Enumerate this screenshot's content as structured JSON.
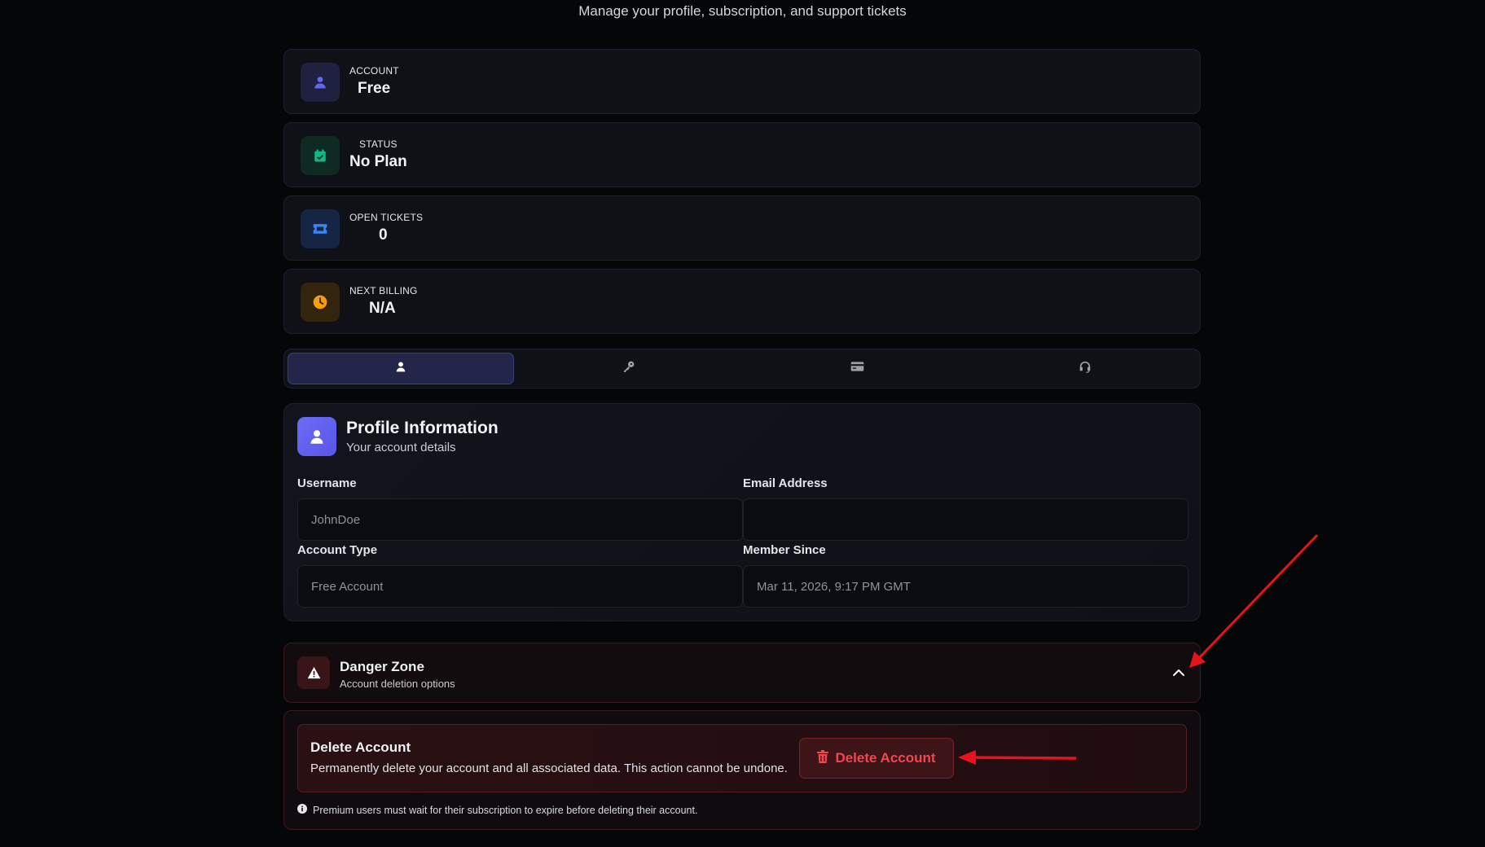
{
  "header": {
    "subtitle": "Manage your profile, subscription, and support tickets"
  },
  "stats": [
    {
      "label": "ACCOUNT",
      "value": "Free",
      "icon": "user-icon",
      "color": "#6366f1",
      "bg": "#1e2140"
    },
    {
      "label": "STATUS",
      "value": "No Plan",
      "icon": "calendar-check-icon",
      "color": "#10b981",
      "bg": "#0f2a22"
    },
    {
      "label": "OPEN TICKETS",
      "value": "0",
      "icon": "ticket-icon",
      "color": "#3b82f6",
      "bg": "#152544"
    },
    {
      "label": "NEXT BILLING",
      "value": "N/A",
      "icon": "clock-icon",
      "color": "#f59e0b",
      "bg": "#33240d"
    }
  ],
  "tabs": [
    {
      "icon": "user-icon",
      "active": true
    },
    {
      "icon": "key-icon",
      "active": false
    },
    {
      "icon": "credit-card-icon",
      "active": false
    },
    {
      "icon": "headset-icon",
      "active": false
    }
  ],
  "profile": {
    "title": "Profile Information",
    "subtitle": "Your account details",
    "fields": {
      "username": {
        "label": "Username",
        "value": "JohnDoe"
      },
      "email": {
        "label": "Email Address",
        "value": ""
      },
      "account_type": {
        "label": "Account Type",
        "value": "Free Account"
      },
      "member_since": {
        "label": "Member Since",
        "value": "Mar 11, 2026, 9:17 PM GMT"
      }
    }
  },
  "danger": {
    "title": "Danger Zone",
    "subtitle": "Account deletion options",
    "delete_title": "Delete Account",
    "delete_desc": "Permanently delete your account and all associated data. This action cannot be undone.",
    "delete_button": "Delete Account",
    "note": "Premium users must wait for their subscription to expire before deleting their account."
  },
  "colors": {
    "accent": "#6366f1",
    "danger": "#ef4444",
    "background": "#050608"
  }
}
